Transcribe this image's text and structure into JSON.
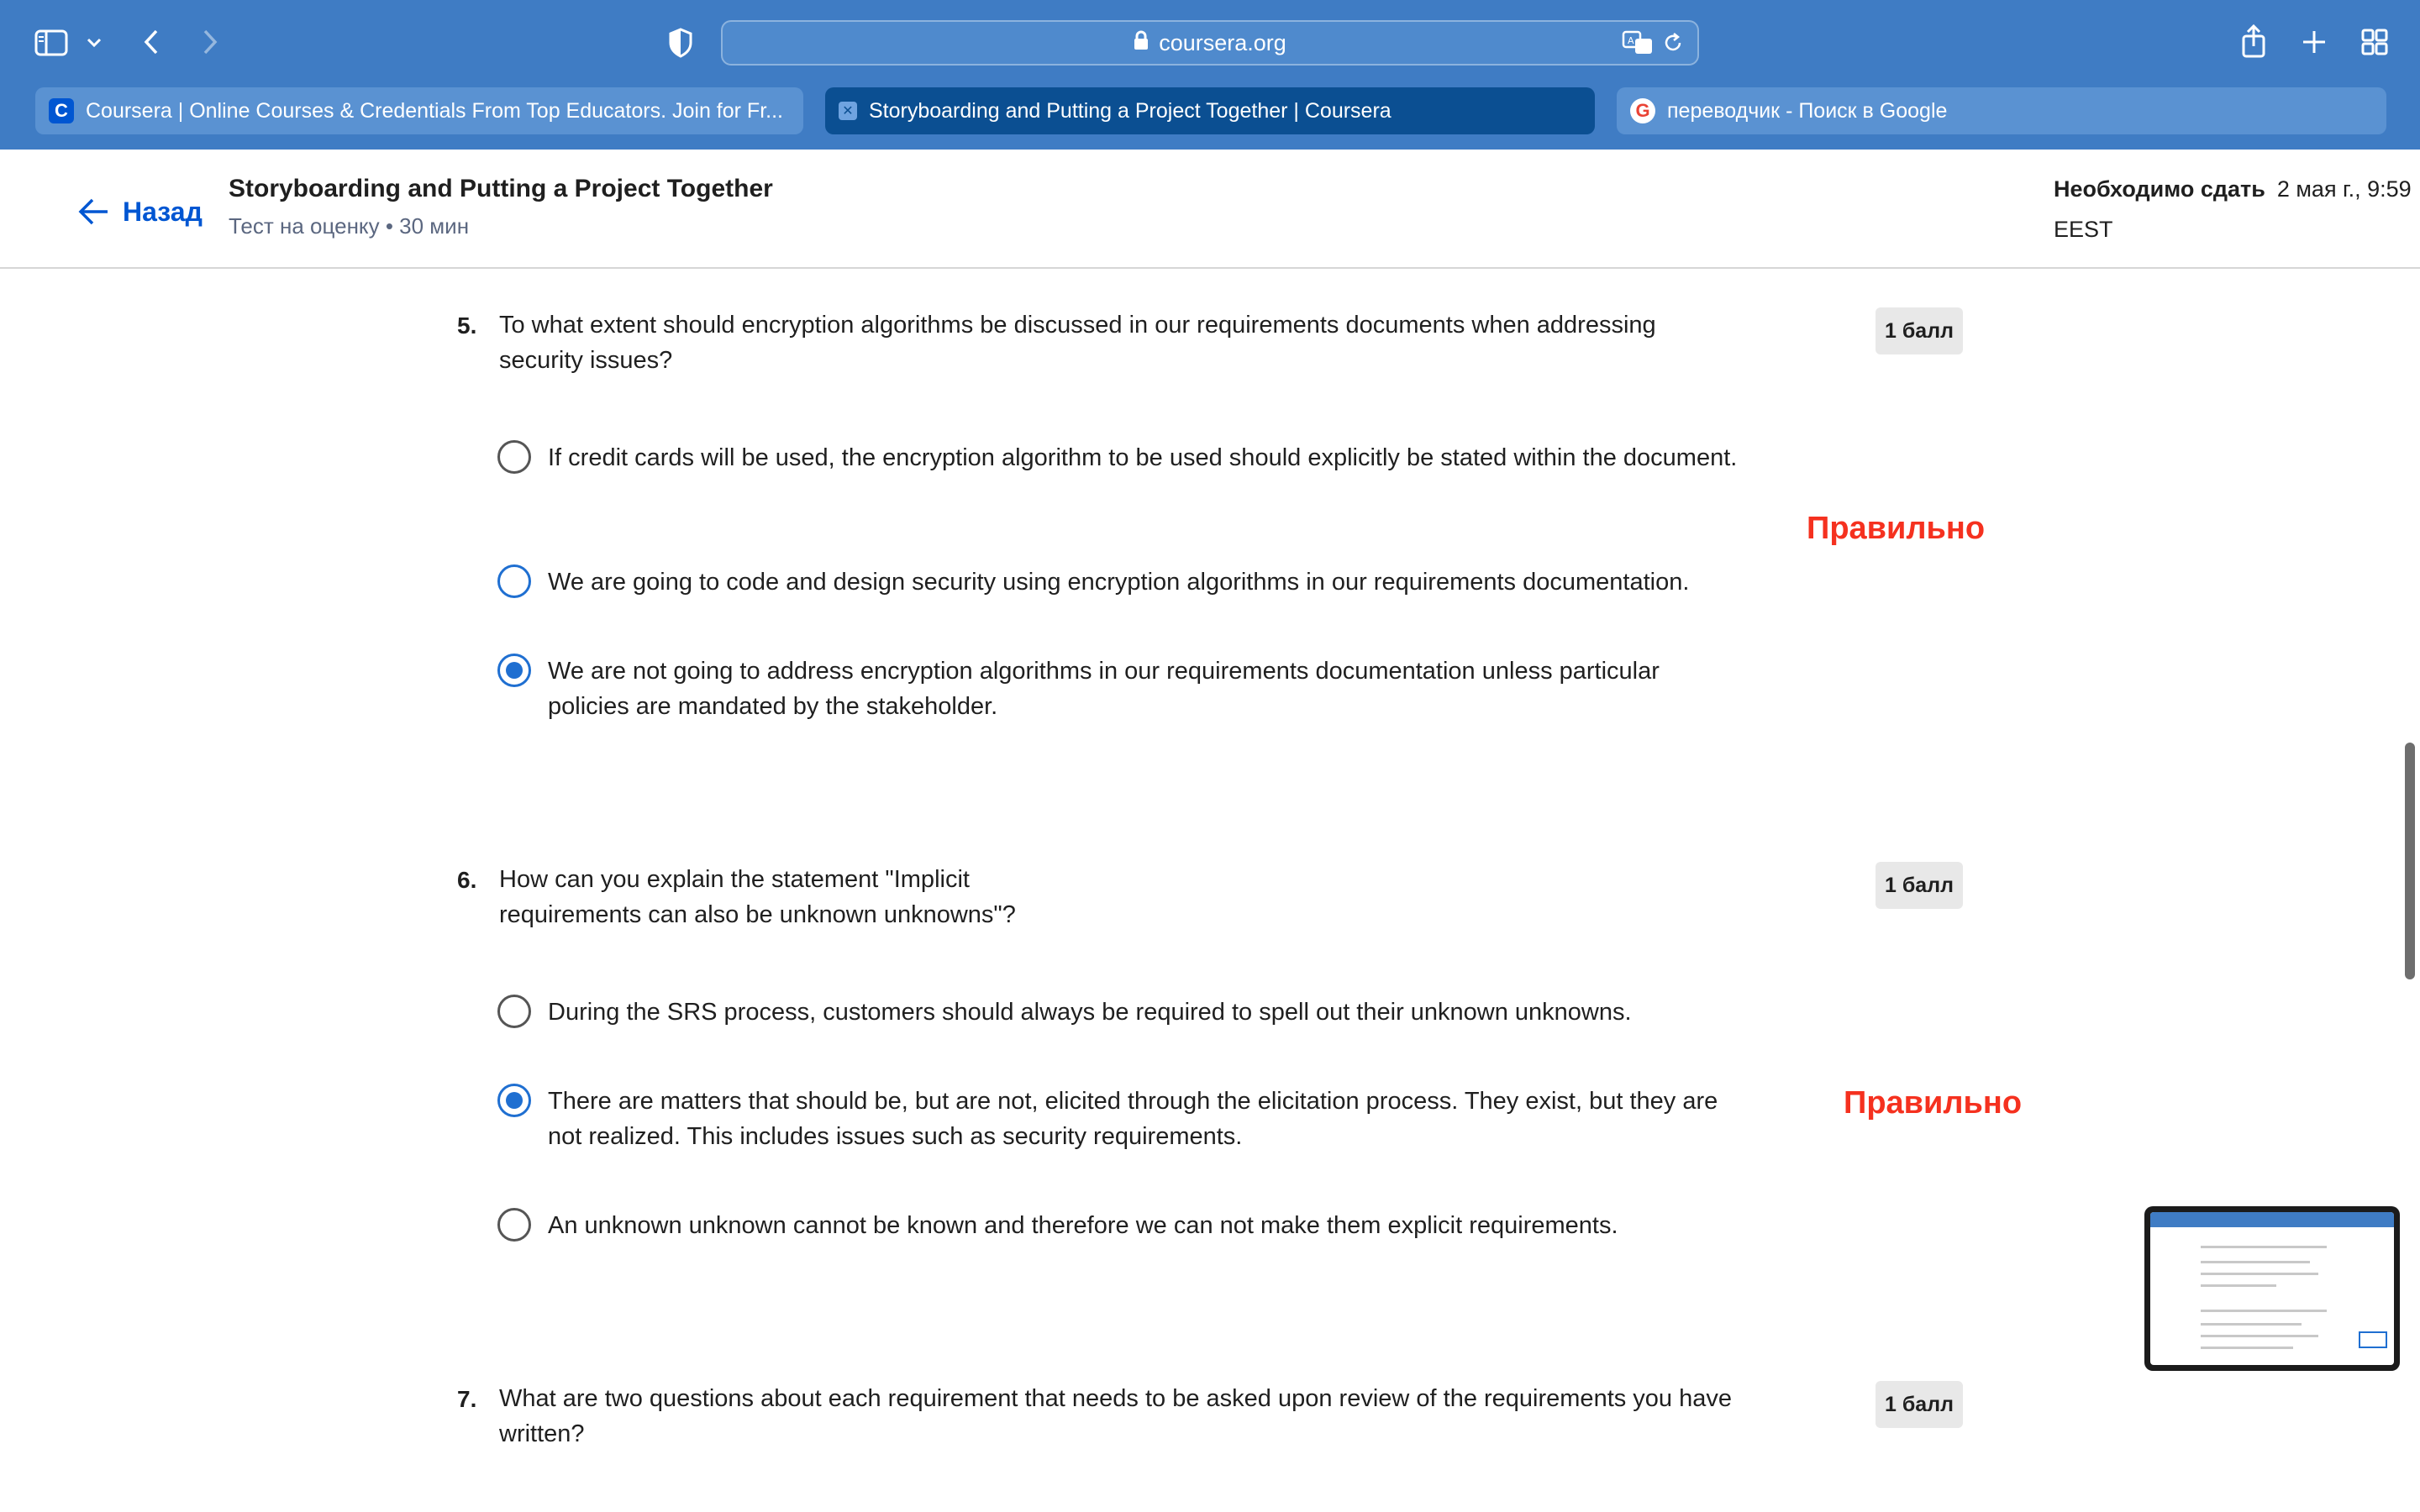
{
  "browser": {
    "url": "coursera.org",
    "tabs": [
      {
        "label": "Coursera | Online Courses & Credentials From Top Educators. Join for Fr...",
        "favicon": "C"
      },
      {
        "label": "Storyboarding and Putting a Project Together | Coursera",
        "favicon": "✕"
      },
      {
        "label": "переводчик - Поиск в Google",
        "favicon": "G"
      }
    ]
  },
  "header": {
    "back_label": "Назад",
    "title": "Storyboarding and Putting a Project Together",
    "subtitle": "Тест на оценку • 30 мин",
    "due_label": "Необходимо сдать",
    "due_date": "2 мая г., 9:59",
    "timezone": "EEST"
  },
  "questions": [
    {
      "number": "5.",
      "text": "To what extent should encryption algorithms be discussed in our requirements documents when addressing security issues?",
      "points": "1 балл",
      "options": [
        {
          "text": "If credit cards will be used, the encryption algorithm to be used should explicitly be stated within the document.",
          "selected": false
        },
        {
          "text": "We are going to code and design security using encryption algorithms in our requirements documentation.",
          "selected": false
        },
        {
          "text": "We are not going to address encryption algorithms in our requirements documentation unless particular policies are mandated by the stakeholder.",
          "selected": true
        }
      ],
      "annotation": "Правильно"
    },
    {
      "number": "6.",
      "text": "How can you explain the statement \"Implicit requirements can also be unknown unknowns\"?",
      "points": "1 балл",
      "options": [
        {
          "text": "During the SRS process, customers should always be required to spell out their unknown unknowns.",
          "selected": false
        },
        {
          "text": "There are matters that should be, but are not, elicited through the elicitation process. They exist, but they are not realized. This includes issues such as security requirements.",
          "selected": true
        },
        {
          "text": "An unknown unknown cannot be known and therefore we can not make them explicit requirements.",
          "selected": false
        }
      ],
      "annotation": "Правильно"
    },
    {
      "number": "7.",
      "text": "What are two questions about each requirement that needs to be asked upon review of the requirements you have written?",
      "points": "1 балл"
    }
  ],
  "colors": {
    "chrome": "#3f7cc4",
    "active_tab": "#0b4f92",
    "link": "#0056d2",
    "radio": "#1f6fd1",
    "annotation": "#f5311f"
  }
}
